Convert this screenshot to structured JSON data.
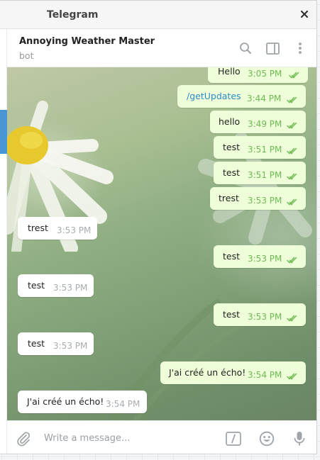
{
  "window": {
    "title": "Telegram"
  },
  "header": {
    "chat_name": "Annoying Weather Master",
    "chat_status": "bot"
  },
  "icons": {
    "close": "close-icon",
    "search": "search-icon",
    "sidebar": "sidebar-toggle-icon",
    "more": "more-vertical-icon",
    "attach": "paperclip-icon",
    "commands": "slash-command-icon",
    "emoji": "emoji-icon",
    "mic": "microphone-icon"
  },
  "colors": {
    "accent": "#4a96d4",
    "outgoing_bubble": "#eefed9",
    "incoming_bubble": "#ffffff",
    "time_outgoing": "#6dbb51",
    "link": "#2b8ac6"
  },
  "messages": [
    {
      "direction": "out",
      "text": "Hello",
      "time": "3:05 PM",
      "read": true
    },
    {
      "direction": "out",
      "text": "/getUpdates",
      "time": "3:44 PM",
      "read": true,
      "is_command": true
    },
    {
      "direction": "out",
      "text": "hello",
      "time": "3:49 PM",
      "read": true
    },
    {
      "direction": "out",
      "text": "test",
      "time": "3:51 PM",
      "read": true
    },
    {
      "direction": "out",
      "text": "test",
      "time": "3:51 PM",
      "read": true
    },
    {
      "direction": "out",
      "text": "trest",
      "time": "3:53 PM",
      "read": true
    },
    {
      "direction": "in",
      "text": "trest",
      "time": "3:53 PM"
    },
    {
      "direction": "out",
      "text": "test",
      "time": "3:53 PM",
      "read": true
    },
    {
      "direction": "in",
      "text": "test",
      "time": "3:53 PM"
    },
    {
      "direction": "out",
      "text": "test",
      "time": "3:53 PM",
      "read": true
    },
    {
      "direction": "in",
      "text": "test",
      "time": "3:53 PM"
    },
    {
      "direction": "out",
      "text": "J'ai créé un écho!",
      "time": "3:54 PM",
      "read": true
    },
    {
      "direction": "in",
      "text": "J'ai créé un écho!",
      "time": "3:54 PM"
    }
  ],
  "composer": {
    "placeholder": "Write a message..."
  }
}
